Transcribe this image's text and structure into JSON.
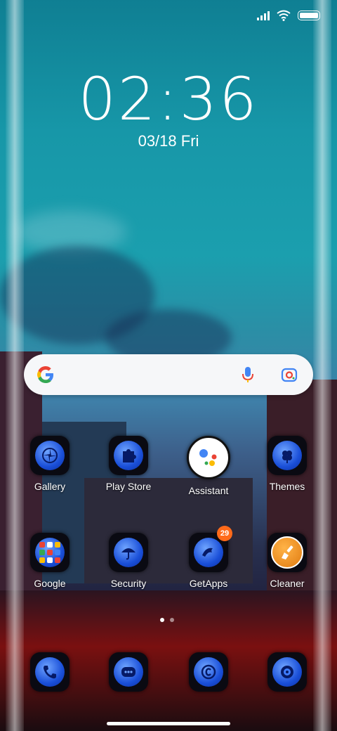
{
  "status_bar": {
    "signal": "signal-icon",
    "wifi": "wifi-icon",
    "battery": "battery-icon"
  },
  "clock": {
    "time": "02:36",
    "date": "03/18",
    "day": "Fri"
  },
  "search_widget": {
    "logo": "G",
    "mic_icon": "microphone-icon",
    "lens_icon": "camera-lens-icon"
  },
  "home_row1": [
    {
      "label": "Gallery",
      "icon": "gallery-icon"
    },
    {
      "label": "Play Store",
      "icon": "puzzle-icon"
    },
    {
      "label": "Assistant",
      "icon": "assistant-icon"
    },
    {
      "label": "Themes",
      "icon": "clover-icon"
    }
  ],
  "home_row2": [
    {
      "label": "Google",
      "icon": "google-folder-icon"
    },
    {
      "label": "Security",
      "icon": "umbrella-icon"
    },
    {
      "label": "GetApps",
      "icon": "dolphin-icon",
      "badge": "29"
    },
    {
      "label": "Cleaner",
      "icon": "brush-icon"
    }
  ],
  "dock": [
    {
      "icon": "phone-icon"
    },
    {
      "icon": "messages-icon"
    },
    {
      "icon": "browser-icon"
    },
    {
      "icon": "camera-icon"
    }
  ],
  "page_indicator": {
    "pages": 2,
    "current": 1
  },
  "colors": {
    "icon_blue": "#1a4fd8",
    "badge_orange": "#ff6a1a"
  }
}
